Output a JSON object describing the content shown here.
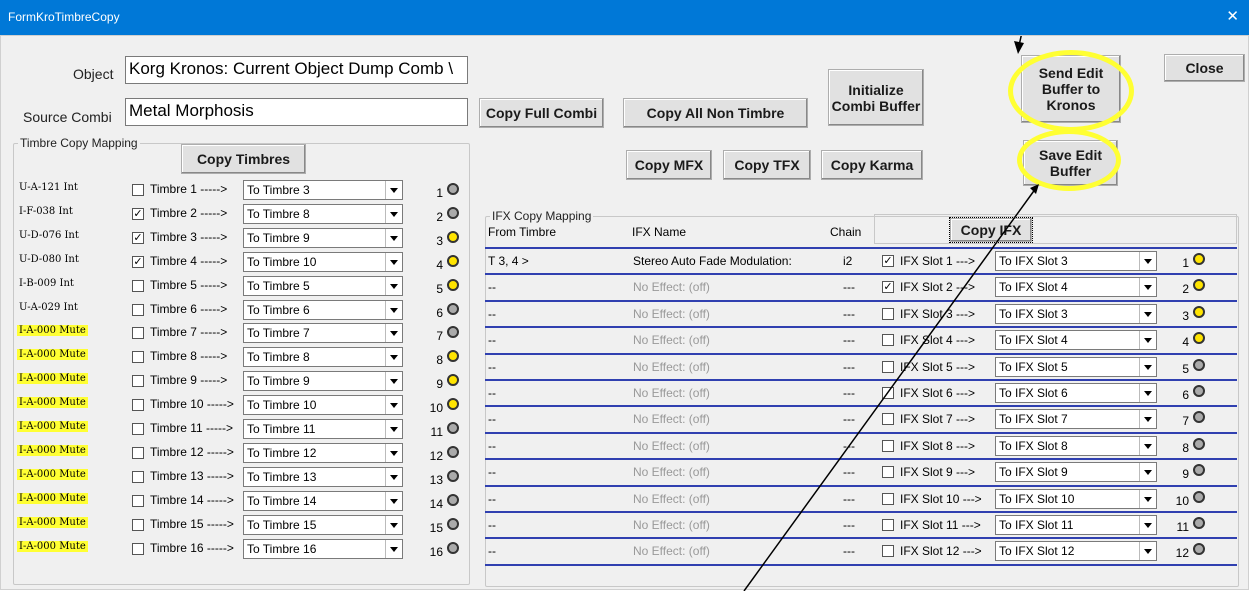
{
  "window": {
    "title": "FormKroTimbreCopy",
    "close_glyph": "✕"
  },
  "object": {
    "label": "Object",
    "value": "Korg Kronos: Current Object Dump Comb \\"
  },
  "source": {
    "label": "Source Combi",
    "value": "Metal Morphosis"
  },
  "buttons": {
    "copy_full_combi": "Copy Full Combi",
    "copy_all_non_timbre": "Copy All Non Timbre",
    "initialize": "Initialize Combi Buffer",
    "send_edit": "Send Edit Buffer to Kronos",
    "close": "Close",
    "copy_timbres": "Copy Timbres",
    "copy_mfx": "Copy MFX",
    "copy_tfx": "Copy TFX",
    "copy_karma": "Copy Karma",
    "save_edit": "Save Edit Buffer",
    "copy_ifx": "Copy IFX"
  },
  "timbre_group": {
    "title": "Timbre Copy Mapping"
  },
  "timbres": [
    {
      "code": "U-A-121 Int",
      "mute": false,
      "checked": false,
      "label": "Timbre 1 ----->",
      "target": "To Timbre  3",
      "num": "1",
      "led": "off"
    },
    {
      "code": "I-F-038 Int",
      "mute": false,
      "checked": true,
      "label": "Timbre 2 ----->",
      "target": "To Timbre  8",
      "num": "2",
      "led": "off"
    },
    {
      "code": "U-D-076 Int",
      "mute": false,
      "checked": true,
      "label": "Timbre 3 ----->",
      "target": "To Timbre  9",
      "num": "3",
      "led": "on"
    },
    {
      "code": "U-D-080 Int",
      "mute": false,
      "checked": true,
      "label": "Timbre 4 ----->",
      "target": "To Timbre 10",
      "num": "4",
      "led": "on"
    },
    {
      "code": "I-B-009 Int",
      "mute": false,
      "checked": false,
      "label": "Timbre 5 ----->",
      "target": "To Timbre  5",
      "num": "5",
      "led": "on"
    },
    {
      "code": "U-A-029 Int",
      "mute": false,
      "checked": false,
      "label": "Timbre 6 ----->",
      "target": "To Timbre  6",
      "num": "6",
      "led": "off"
    },
    {
      "code": "I-A-000 Mute",
      "mute": true,
      "checked": false,
      "label": "Timbre 7 ----->",
      "target": "To Timbre  7",
      "num": "7",
      "led": "off"
    },
    {
      "code": "I-A-000 Mute",
      "mute": true,
      "checked": false,
      "label": "Timbre 8 ----->",
      "target": "To Timbre  8",
      "num": "8",
      "led": "on"
    },
    {
      "code": "I-A-000 Mute",
      "mute": true,
      "checked": false,
      "label": "Timbre 9 ----->",
      "target": "To Timbre  9",
      "num": "9",
      "led": "on"
    },
    {
      "code": "I-A-000 Mute",
      "mute": true,
      "checked": false,
      "label": "Timbre 10 ----->",
      "target": "To Timbre 10",
      "num": "10",
      "led": "on"
    },
    {
      "code": "I-A-000 Mute",
      "mute": true,
      "checked": false,
      "label": "Timbre 11 ----->",
      "target": "To Timbre 11",
      "num": "11",
      "led": "off"
    },
    {
      "code": "I-A-000 Mute",
      "mute": true,
      "checked": false,
      "label": "Timbre 12 ----->",
      "target": "To Timbre 12",
      "num": "12",
      "led": "off"
    },
    {
      "code": "I-A-000 Mute",
      "mute": true,
      "checked": false,
      "label": "Timbre 13 ----->",
      "target": "To Timbre 13",
      "num": "13",
      "led": "off"
    },
    {
      "code": "I-A-000 Mute",
      "mute": true,
      "checked": false,
      "label": "Timbre 14 ----->",
      "target": "To Timbre 14",
      "num": "14",
      "led": "off"
    },
    {
      "code": "I-A-000 Mute",
      "mute": true,
      "checked": false,
      "label": "Timbre 15 ----->",
      "target": "To Timbre 15",
      "num": "15",
      "led": "off"
    },
    {
      "code": "I-A-000 Mute",
      "mute": true,
      "checked": false,
      "label": "Timbre 16 ----->",
      "target": "To Timbre 16",
      "num": "16",
      "led": "off"
    }
  ],
  "ifx_group": {
    "title": "IFX Copy Mapping",
    "col_from": "From Timbre",
    "col_name": "IFX Name",
    "col_chain": "Chain"
  },
  "ifx": [
    {
      "from": "T 3, 4 >",
      "name": "Stereo Auto Fade Modulation:",
      "dim": false,
      "chain": "i2",
      "checked": true,
      "label": "IFX Slot 1 --->",
      "target": "To IFX Slot  3",
      "num": "1",
      "led": "on"
    },
    {
      "from": "--",
      "name": "No Effect: (off)",
      "dim": true,
      "chain": "---",
      "checked": true,
      "label": "IFX Slot 2 --->",
      "target": "To IFX Slot  4",
      "num": "2",
      "led": "on"
    },
    {
      "from": "--",
      "name": "No Effect: (off)",
      "dim": true,
      "chain": "---",
      "checked": false,
      "label": "IFX Slot 3 --->",
      "target": "To IFX Slot  3",
      "num": "3",
      "led": "on"
    },
    {
      "from": "--",
      "name": "No Effect: (off)",
      "dim": true,
      "chain": "---",
      "checked": false,
      "label": "IFX Slot 4 --->",
      "target": "To IFX Slot  4",
      "num": "4",
      "led": "on"
    },
    {
      "from": "--",
      "name": "No Effect: (off)",
      "dim": true,
      "chain": "---",
      "checked": false,
      "label": "IFX Slot 5 --->",
      "target": "To IFX Slot  5",
      "num": "5",
      "led": "off"
    },
    {
      "from": "--",
      "name": "No Effect: (off)",
      "dim": true,
      "chain": "---",
      "checked": false,
      "label": "IFX Slot 6 --->",
      "target": "To IFX Slot  6",
      "num": "6",
      "led": "off"
    },
    {
      "from": "--",
      "name": "No Effect: (off)",
      "dim": true,
      "chain": "---",
      "checked": false,
      "label": "IFX Slot 7 --->",
      "target": "To IFX Slot  7",
      "num": "7",
      "led": "off"
    },
    {
      "from": "--",
      "name": "No Effect: (off)",
      "dim": true,
      "chain": "---",
      "checked": false,
      "label": "IFX Slot 8 --->",
      "target": "To IFX Slot  8",
      "num": "8",
      "led": "off"
    },
    {
      "from": "--",
      "name": "No Effect: (off)",
      "dim": true,
      "chain": "---",
      "checked": false,
      "label": "IFX Slot 9 --->",
      "target": "To IFX Slot  9",
      "num": "9",
      "led": "off"
    },
    {
      "from": "--",
      "name": "No Effect: (off)",
      "dim": true,
      "chain": "---",
      "checked": false,
      "label": "IFX Slot 10 --->",
      "target": "To IFX Slot 10",
      "num": "10",
      "led": "off"
    },
    {
      "from": "--",
      "name": "No Effect: (off)",
      "dim": true,
      "chain": "---",
      "checked": false,
      "label": "IFX Slot 11 --->",
      "target": "To IFX Slot 11",
      "num": "11",
      "led": "off"
    },
    {
      "from": "--",
      "name": "No Effect: (off)",
      "dim": true,
      "chain": "---",
      "checked": false,
      "label": "IFX Slot 12 --->",
      "target": "To IFX Slot 12",
      "num": "12",
      "led": "off"
    }
  ]
}
